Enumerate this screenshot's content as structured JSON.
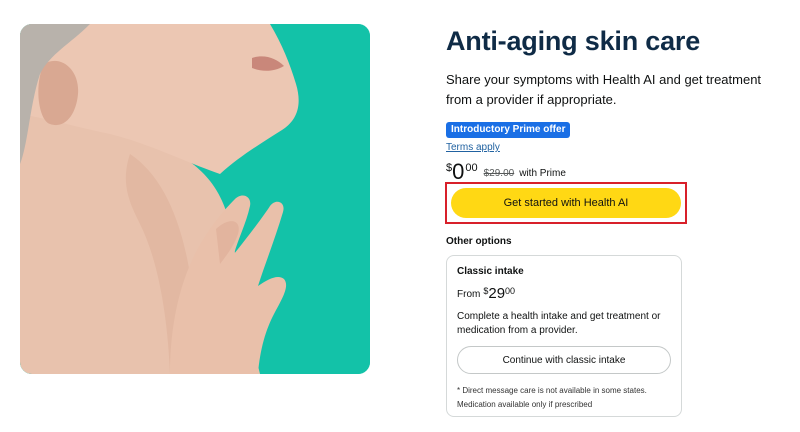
{
  "hero": {
    "image": "woman-neck-hand-photo",
    "background_color": "#13c2a8"
  },
  "header": {
    "title": "Anti-aging skin care",
    "subtitle": "Share your symptoms with Health AI and get treatment from a provider if appropriate."
  },
  "offer": {
    "badge": "Introductory Prime offer",
    "terms": "Terms apply",
    "price_symbol": "$",
    "price_main": "0",
    "price_cents": "00",
    "original_price": "$29.00",
    "price_note": "with Prime"
  },
  "cta": {
    "label": "Get started with Health AI",
    "color": "#ffd814",
    "highlight_color": "#d8202a"
  },
  "other_options": {
    "heading": "Other options",
    "card": {
      "title": "Classic intake",
      "from": "From",
      "price_symbol": "$",
      "price_main": "29",
      "price_cents": "00",
      "description": "Complete a health intake and get treatment or medication from a provider.",
      "button": "Continue with classic intake",
      "disclaimer_1": "* Direct message care is not available in some states.",
      "disclaimer_2": "Medication available only if prescribed"
    }
  }
}
